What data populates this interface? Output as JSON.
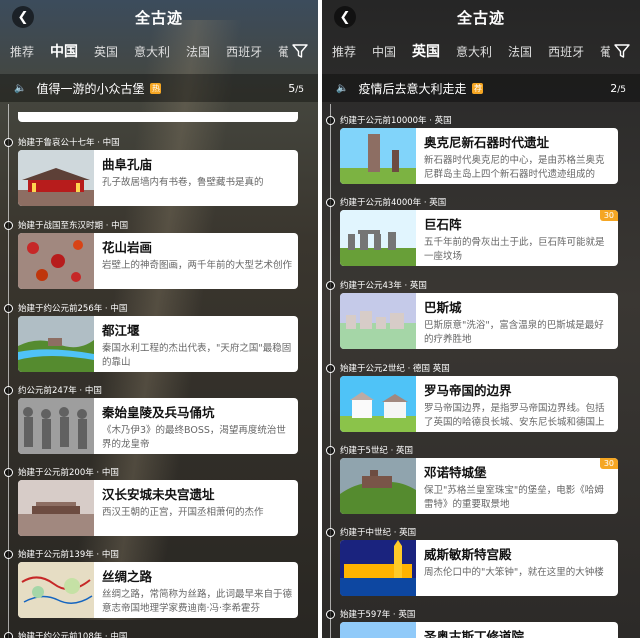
{
  "left": {
    "title": "全古迹",
    "back_icon": "chevron-left-icon",
    "tabs": [
      {
        "label": "推荐",
        "active": false
      },
      {
        "label": "中国",
        "active": true
      },
      {
        "label": "英国",
        "active": false
      },
      {
        "label": "意大利",
        "active": false
      },
      {
        "label": "法国",
        "active": false
      },
      {
        "label": "西班牙",
        "active": false
      },
      {
        "label": "葡",
        "active": false
      }
    ],
    "banner": {
      "text": "值得一游的小众古堡",
      "hot": "热",
      "count": "5",
      "total": "/5"
    },
    "entries": [
      {
        "label": "始建于鲁哀公十七年 · 中国",
        "title": "曲阜孔庙",
        "desc": "孔子故居墙内有书卷，鲁壁藏书是真的",
        "thumb": "temple"
      },
      {
        "label": "始建于战国至东汉时期 · 中国",
        "title": "花山岩画",
        "desc": "岩壁上的神奇图画，两千年前的大型艺术创作",
        "thumb": "rock"
      },
      {
        "label": "始建于约公元前256年 · 中国",
        "title": "都江堰",
        "desc": "秦国水利工程的杰出代表，\"天府之国\"最稳固的靠山",
        "thumb": "river"
      },
      {
        "label": "约公元前247年 · 中国",
        "title": "秦始皇陵及兵马俑坑",
        "desc": "《木乃伊3》的最终BOSS，渴望再度统治世界的龙皇帝",
        "thumb": "warriors"
      },
      {
        "label": "始建于公元前200年 · 中国",
        "title": "汉长安城未央宫遗址",
        "desc": "西汉王朝的正宫，开国丞相萧何的杰作",
        "thumb": "ruins"
      },
      {
        "label": "始建于公元前139年 · 中国",
        "title": "丝绸之路",
        "desc": "丝绸之路，常简称为丝路，此词最早来自于德意志帝国地理学家费迪南·冯·李希霍芬",
        "thumb": "map"
      }
    ],
    "partial_label": "始建于约公元前108年 · 中国"
  },
  "right": {
    "title": "全古迹",
    "back_icon": "chevron-left-icon",
    "tabs": [
      {
        "label": "推荐",
        "active": false
      },
      {
        "label": "中国",
        "active": false
      },
      {
        "label": "英国",
        "active": true
      },
      {
        "label": "意大利",
        "active": false
      },
      {
        "label": "法国",
        "active": false
      },
      {
        "label": "西班牙",
        "active": false
      },
      {
        "label": "葡",
        "active": false
      }
    ],
    "banner": {
      "text": "疫情后去意大利走走",
      "hot": "荐",
      "count": "2",
      "total": "/5"
    },
    "entries": [
      {
        "label": "约建于公元前10000年 · 英国",
        "title": "奥克尼新石器时代遗址",
        "desc": "新石器时代奥克尼的中心，是由苏格兰奥克尼群岛主岛上四个新石器时代遗迹组成的",
        "thumb": "orkney",
        "score": ""
      },
      {
        "label": "约建于公元前4000年 · 英国",
        "title": "巨石阵",
        "desc": "五千年前的骨灰出土于此，巨石阵可能就是一座坟场",
        "thumb": "stonehenge",
        "score": "30"
      },
      {
        "label": "约建于公元43年 · 英国",
        "title": "巴斯城",
        "desc": "巴斯原意\"洗浴\"，富含温泉的巴斯城是最好的疗养胜地",
        "thumb": "bath",
        "score": ""
      },
      {
        "label": "始建于公元2世纪 · 德国 英国",
        "title": "罗马帝国的边界",
        "desc": "罗马帝国边界，是指罗马帝国边界线。包括了英国的哈德良长城、安东尼长城和德国上日耳曼-雷蒂亚边墙",
        "thumb": "limes",
        "score": ""
      },
      {
        "label": "约建于5世纪 · 英国",
        "title": "邓诺特城堡",
        "desc": "保卫\"苏格兰皇室珠宝\"的堡垒，电影《哈姆雷特》的重要取景地",
        "thumb": "dunnottar",
        "score": "30"
      },
      {
        "label": "约建于中世纪 · 英国",
        "title": "威斯敏斯特宫殿",
        "desc": "周杰伦口中的\"大笨钟\"，就在这里的大钟楼",
        "thumb": "westminster",
        "score": ""
      }
    ],
    "partial": {
      "label": "始建于597年 · 英国",
      "title": "圣奥古斯丁修道院"
    }
  }
}
